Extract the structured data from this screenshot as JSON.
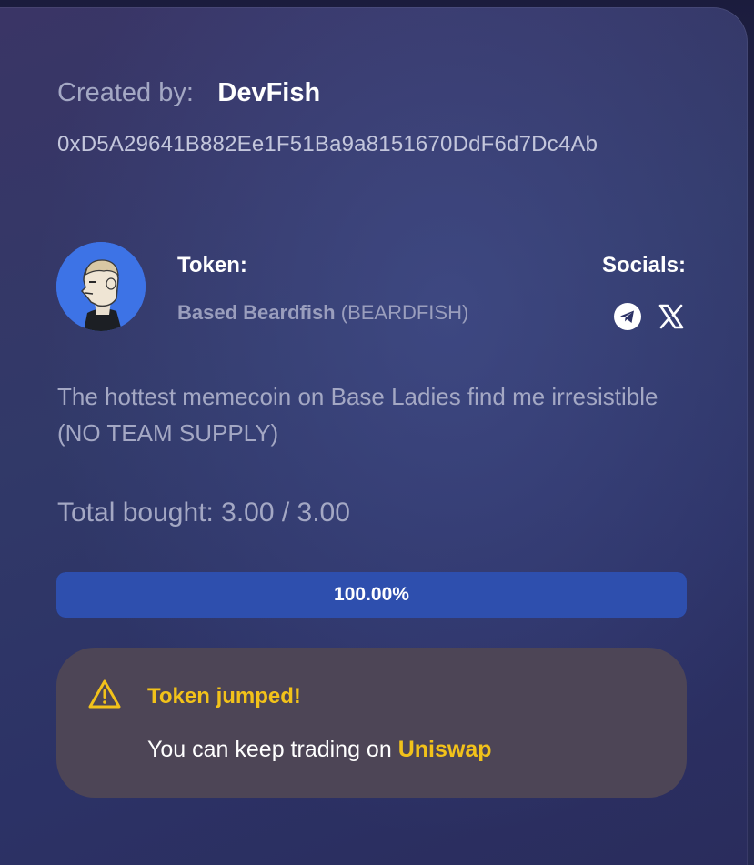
{
  "creator": {
    "label": "Created by:",
    "name": "DevFish",
    "address": "0xD5A29641B882Ee1F51Ba9a8151670DdF6d7Dc4Ab"
  },
  "token": {
    "label": "Token:",
    "name": "Based Beardfish",
    "symbol": "(BEARDFISH)",
    "avatar_icon": "beardfish-avatar"
  },
  "socials": {
    "label": "Socials:",
    "items": [
      {
        "icon": "telegram-icon"
      },
      {
        "icon": "x-icon"
      }
    ]
  },
  "description": "The hottest memecoin on Base Ladies find me irresistible (NO TEAM SUPPLY)",
  "progress": {
    "total_bought_text": "Total bought: 3.00 / 3.00",
    "percent": 100,
    "percent_label": "100.00%"
  },
  "alert": {
    "icon": "warning-icon",
    "title": "Token jumped!",
    "body": "You can keep trading on",
    "link_text": "Uniswap"
  },
  "colors": {
    "accent_yellow": "#f2c21a",
    "progress_fill": "#2e4fae",
    "alert_bg": "#4d4556",
    "avatar_bg": "#3d73e6"
  }
}
